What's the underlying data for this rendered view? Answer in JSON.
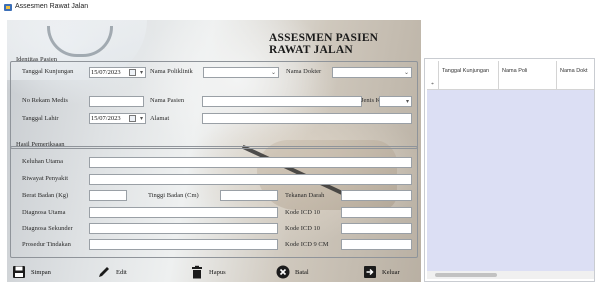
{
  "window": {
    "title": "Assesmen Rawat Jalan"
  },
  "form": {
    "title": "ASSESMEN PASIEN RAWAT JALAN",
    "identitas": {
      "group_label": "Identitas Pasien",
      "tgl_kunjungan_label": "Tanggal Kunjungan",
      "tgl_kunjungan_value": "15/07/2023",
      "nama_poli_label": "Nama Poliklinik",
      "nama_dokter_label": "Nama Dokter",
      "no_rekam_medis_label": "No Rekam Medis",
      "nama_pasien_label": "Nama Pasien",
      "jenis_kelamin_label": "Jenis Kelamin",
      "tgl_lahir_label": "Tanggal Lahir",
      "tgl_lahir_value": "15/07/2023",
      "alamat_label": "Alamat"
    },
    "hasil": {
      "group_label": "Hasil Pemeriksaan",
      "keluhan_label": "Keluhan Utama",
      "riwayat_label": "Riwayat Penyakit",
      "berat_label": "Berat Badan (Kg)",
      "tinggi_label": "Tinggi Badan (Cm)",
      "diag_utama_label": "Diagnosa Utama",
      "diag_sekunder_label": "Diagnosa Sekunder",
      "prosedur_label": "Prosedur Tindakan",
      "tekanan_label": "Tekanan Darah",
      "icd_utama_label": "Kode ICD 10",
      "icd_sekunder_label": "Kode ICD 10",
      "icd9_label": "Kode ICD 9 CM"
    }
  },
  "buttons": {
    "simpan": "Simpan",
    "edit": "Edit",
    "hapus": "Hapus",
    "batal": "Batal",
    "keluar": "Keluar"
  },
  "grid": {
    "columns": [
      "Tanggal Kunjungan",
      "Nama Poli",
      "Nama Dokt"
    ],
    "new_row_marker": "*"
  },
  "icons": [
    "app-icon",
    "calendar-icon",
    "dropdown-arrow-icon",
    "save-icon",
    "pencil-icon",
    "trash-icon",
    "cancel-icon",
    "exit-icon"
  ]
}
